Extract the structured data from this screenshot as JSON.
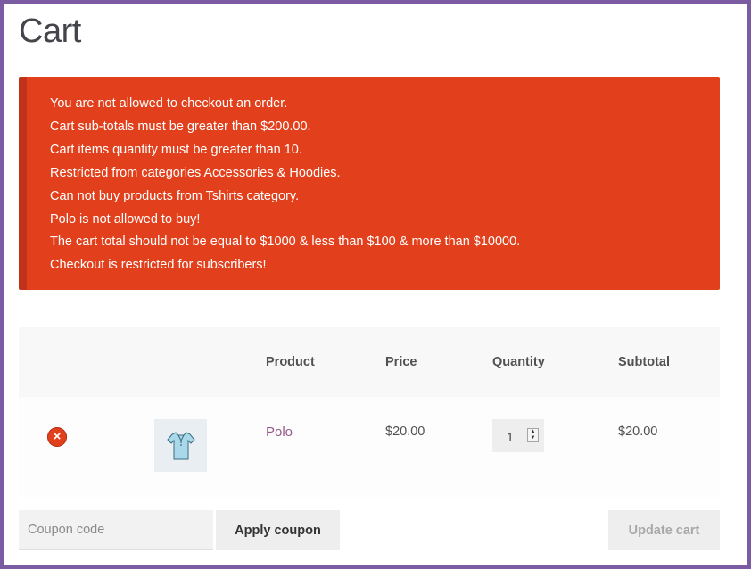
{
  "page": {
    "title": "Cart"
  },
  "notice": {
    "messages": [
      "You are not allowed to checkout an order.",
      "Cart sub-totals must be greater than $200.00.",
      "Cart items quantity must be greater than 10.",
      "Restricted from categories Accessories & Hoodies.",
      "Can not buy products from Tshirts category.",
      "Polo is not allowed to buy!",
      "The cart total should not be equal to $1000 & less than $100 & more than $10000.",
      "Checkout is restricted for subscribers!"
    ]
  },
  "table": {
    "headers": {
      "product": "Product",
      "price": "Price",
      "quantity": "Quantity",
      "subtotal": "Subtotal"
    },
    "rows": [
      {
        "remove_symbol": "×",
        "thumbnail_icon": "polo-shirt-icon",
        "product": "Polo",
        "price": "$20.00",
        "quantity": "1",
        "subtotal": "$20.00"
      }
    ]
  },
  "actions": {
    "coupon_placeholder": "Coupon code",
    "apply_coupon": "Apply coupon",
    "update_cart": "Update cart"
  },
  "colors": {
    "frame": "#7b5ba1",
    "error_notice": "#e2401c",
    "product_link": "#96588a"
  }
}
